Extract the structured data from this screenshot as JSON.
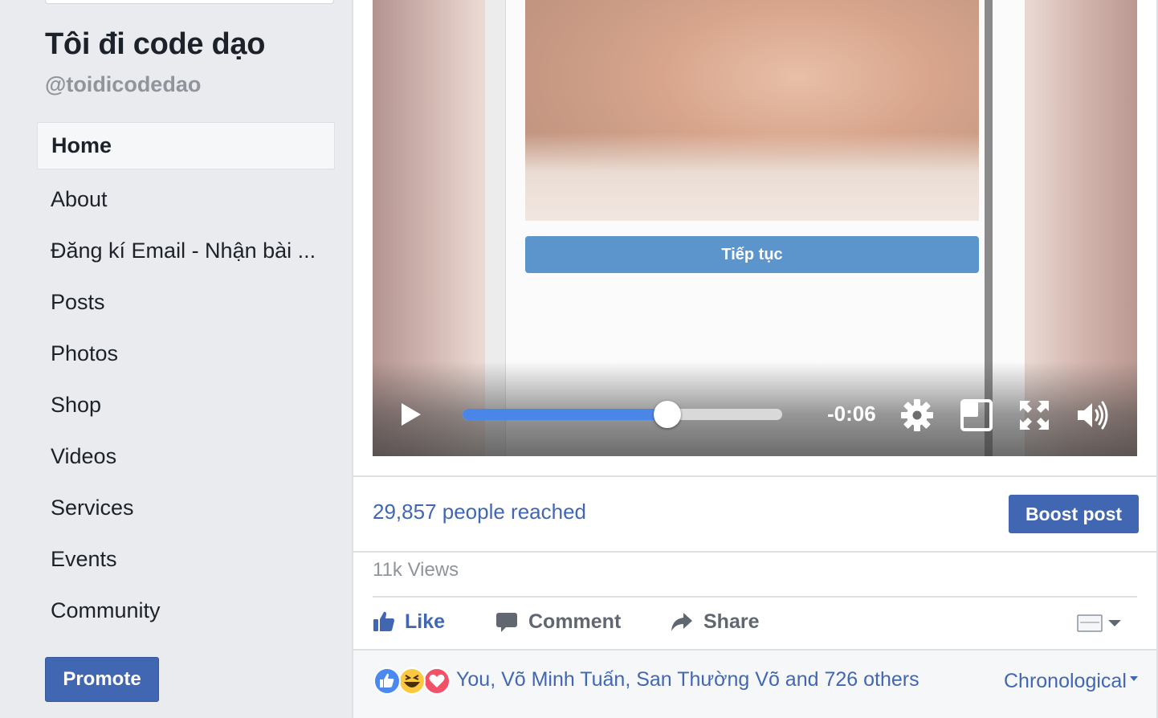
{
  "sidebar": {
    "page_name": "Tôi đi code dạo",
    "page_handle": "@toidicodedao",
    "nav": [
      {
        "label": "Home",
        "active": true
      },
      {
        "label": "About"
      },
      {
        "label": "Đăng kí Email - Nhận bài ..."
      },
      {
        "label": "Posts"
      },
      {
        "label": "Photos"
      },
      {
        "label": "Shop"
      },
      {
        "label": "Videos"
      },
      {
        "label": "Services"
      },
      {
        "label": "Events"
      },
      {
        "label": "Community"
      }
    ],
    "promote_label": "Promote"
  },
  "video": {
    "continue_button_label": "Tiếp tục",
    "time_remaining": "-0:06",
    "progress_fraction": 0.64,
    "icons": [
      "play-icon",
      "settings-gear-icon",
      "picture-in-picture-icon",
      "fullscreen-icon",
      "volume-icon"
    ]
  },
  "post": {
    "reach_text": "29,857 people reached",
    "boost_label": "Boost post",
    "views_text": "11k Views",
    "actions": {
      "like": "Like",
      "comment": "Comment",
      "share": "Share"
    },
    "reactions_text": "You, Võ Minh Tuấn, San Thường Võ and 726 others",
    "reaction_icons": [
      "like-reaction-icon",
      "haha-reaction-icon",
      "love-reaction-icon"
    ],
    "comment_order": "Chronological"
  },
  "colors": {
    "brand_blue": "#4267b2",
    "background": "#e9ebee",
    "progress_blue": "#4a86e8"
  }
}
